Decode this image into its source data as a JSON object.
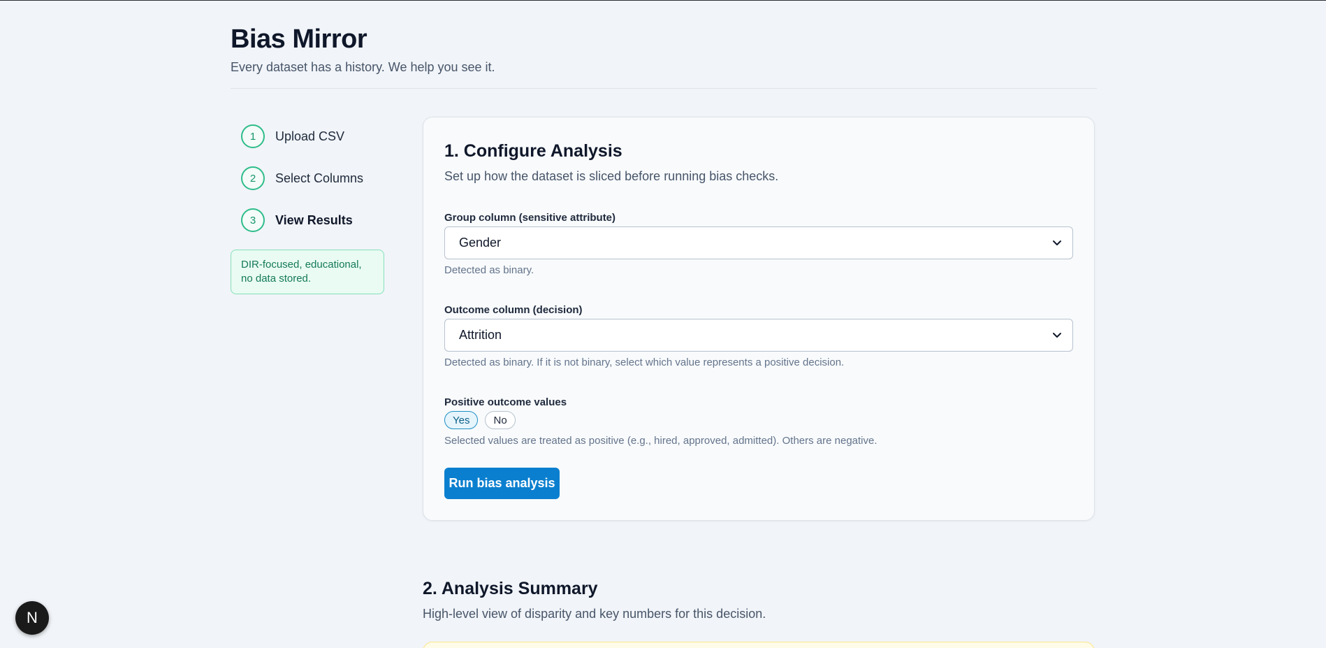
{
  "header": {
    "title": "Bias Mirror",
    "subtitle": "Every dataset has a history. We help you see it."
  },
  "sidebar": {
    "steps": [
      {
        "number": "1",
        "label": "Upload CSV"
      },
      {
        "number": "2",
        "label": "Select Columns"
      },
      {
        "number": "3",
        "label": "View Results"
      }
    ],
    "active_step": 3,
    "note": "DIR-focused, educational, no data stored."
  },
  "configure": {
    "title": "1. Configure Analysis",
    "description": "Set up how the dataset is sliced before running bias checks.",
    "group": {
      "label": "Group column (sensitive attribute)",
      "value": "Gender",
      "hint": "Detected as binary."
    },
    "outcome": {
      "label": "Outcome column (decision)",
      "value": "Attrition",
      "hint": "Detected as binary. If it is not binary, select which value represents a positive decision."
    },
    "positive": {
      "label": "Positive outcome values",
      "options": [
        "Yes",
        "No"
      ],
      "selected": [
        "Yes"
      ],
      "hint": "Selected values are treated as positive (e.g., hired, approved, admitted). Others are negative."
    },
    "run_button": "Run bias analysis"
  },
  "summary": {
    "title": "2. Analysis Summary",
    "description": "High-level view of disparity and key numbers for this decision."
  },
  "badge": {
    "letter": "N"
  },
  "colors": {
    "accent": "#0b7fcf",
    "step_ring": "#2ebd8a",
    "note_bg": "#e9fbf3",
    "background": "#f1f4f8"
  }
}
